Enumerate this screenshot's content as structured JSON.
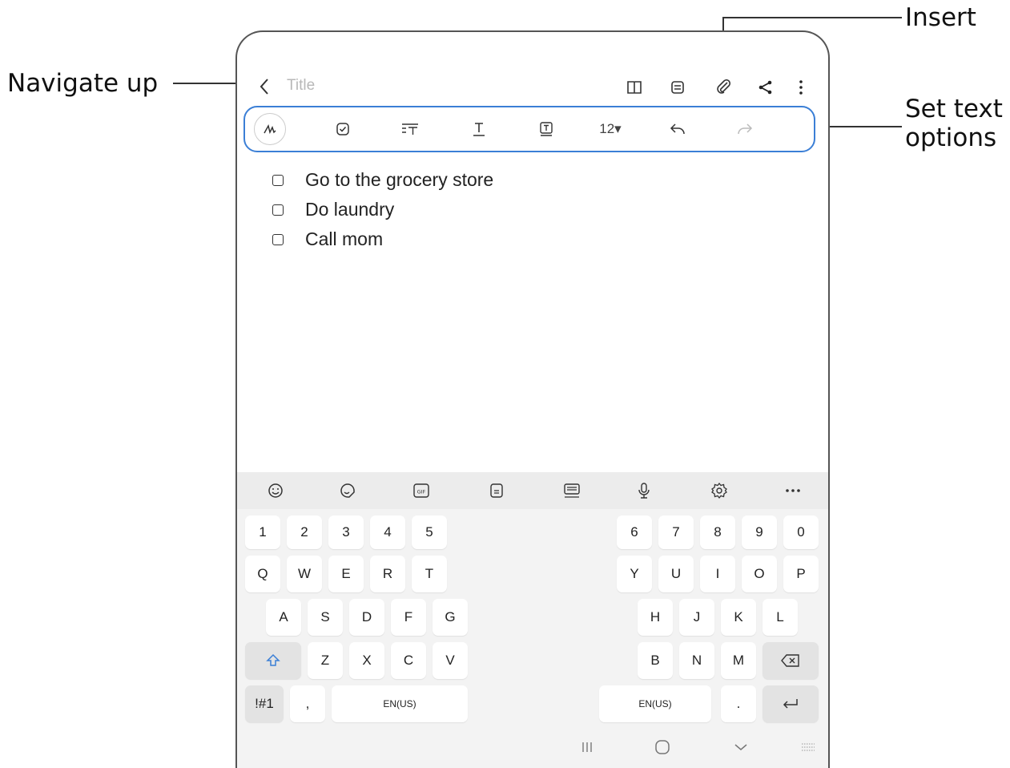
{
  "annotations": {
    "navigate_up": "Navigate up",
    "insert": "Insert",
    "set_text_line1": "Set text",
    "set_text_line2": "options"
  },
  "note": {
    "title_placeholder": "Title",
    "checklist": [
      "Go to the grocery store",
      "Do laundry",
      "Call mom"
    ]
  },
  "toolbar": {
    "font_size": "12▾"
  },
  "icons": {
    "top": [
      "back-icon",
      "book-icon",
      "note-list-icon",
      "attach-icon",
      "share-icon",
      "more-vert-icon"
    ],
    "format": [
      "handwriting-icon",
      "checkbox-icon",
      "paragraph-icon",
      "text-style-icon",
      "text-box-icon",
      "undo-icon",
      "redo-icon"
    ],
    "keyboard_tools": [
      "emoji-icon",
      "sticker-icon",
      "gif-icon",
      "clipboard-icon",
      "keyboard-mode-icon",
      "mic-icon",
      "settings-icon",
      "more-icon"
    ]
  },
  "keyboard": {
    "numbers_left": [
      "1",
      "2",
      "3",
      "4",
      "5"
    ],
    "numbers_right": [
      "6",
      "7",
      "8",
      "9",
      "0"
    ],
    "row1_left": [
      "Q",
      "W",
      "E",
      "R",
      "T"
    ],
    "row1_right": [
      "Y",
      "U",
      "I",
      "O",
      "P"
    ],
    "row2_left": [
      "A",
      "S",
      "D",
      "F",
      "G"
    ],
    "row2_right": [
      "H",
      "J",
      "K",
      "L"
    ],
    "row3_left": [
      "Z",
      "X",
      "C",
      "V"
    ],
    "row3_right": [
      "B",
      "N",
      "M"
    ],
    "symbols": "!#1",
    "comma": ",",
    "space_label": "EN(US)",
    "period": "."
  },
  "colors": {
    "accent": "#3b7fd6",
    "annotation_line": "#333333",
    "keyboard_bg": "#f3f3f3"
  }
}
